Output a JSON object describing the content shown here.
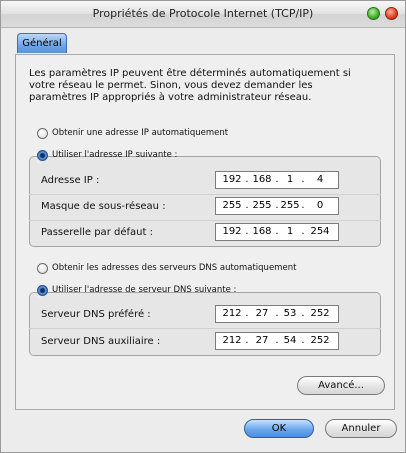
{
  "window": {
    "title": "Propriétés de Protocole Internet (TCP/IP)",
    "controls": [
      "green-zoom-icon",
      "red-close-icon"
    ]
  },
  "tabs": [
    {
      "label": "Général",
      "selected": true
    }
  ],
  "intro_text": "Les paramètres IP peuvent être déterminés automatiquement si votre réseau le permet. Sinon, vous devez demander les paramètres IP appropriés à votre administrateur réseau.",
  "ip_section": {
    "auto_option": {
      "label": "Obtenir une adresse IP automatiquement",
      "selected": false
    },
    "manual_option": {
      "label": "Utiliser l'adresse IP suivante :",
      "selected": true
    },
    "fields": [
      {
        "label": "Adresse IP :",
        "octets": [
          "192",
          "168",
          "1",
          "4"
        ]
      },
      {
        "label": "Masque de sous-réseau :",
        "octets": [
          "255",
          "255",
          "255",
          "0"
        ]
      },
      {
        "label": "Passerelle par défaut :",
        "octets": [
          "192",
          "168",
          "1",
          "254"
        ]
      }
    ]
  },
  "dns_section": {
    "auto_option": {
      "label": "Obtenir les adresses des serveurs DNS automatiquement",
      "selected": false
    },
    "manual_option": {
      "label": "Utiliser l'adresse de serveur DNS suivante :",
      "selected": true
    },
    "fields": [
      {
        "label": "Serveur DNS préféré :",
        "octets": [
          "212",
          "27",
          "53",
          "252"
        ]
      },
      {
        "label": "Serveur DNS auxiliaire :",
        "octets": [
          "212",
          "27",
          "54",
          "252"
        ]
      }
    ]
  },
  "buttons": {
    "advanced": "Avancé...",
    "ok": "OK",
    "cancel": "Annuler"
  },
  "colors": {
    "accent": "#5b92d8",
    "window_bg": "#ececec"
  }
}
